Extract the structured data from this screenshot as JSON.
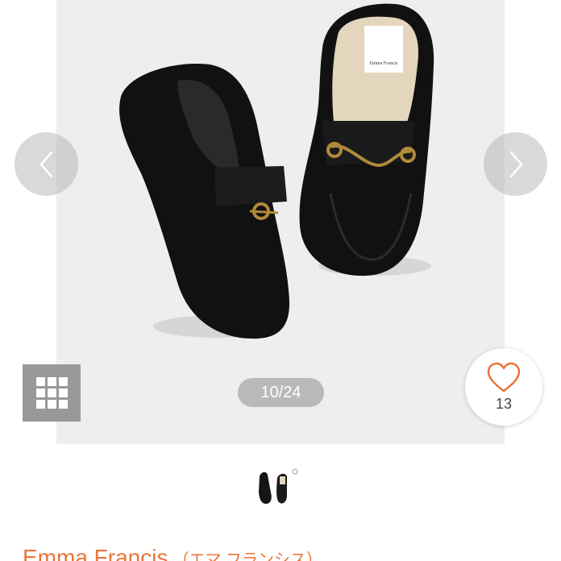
{
  "gallery": {
    "counter_current": "10",
    "counter_separator": "/",
    "counter_total": "24",
    "like_count": "13",
    "insole_brand_text": "Emma Francis"
  },
  "thumbnails": [
    {
      "selected": true
    }
  ],
  "product": {
    "brand_name": "Emma Francis",
    "brand_kana": "（エマ フランシス）"
  },
  "colors": {
    "accent": "#e8753a",
    "heart": "#e8753a",
    "photo_background": "#eeeeed"
  },
  "icons": {
    "prev": "chevron-left-icon",
    "next": "chevron-right-icon",
    "grid": "grid-icon",
    "like": "heart-icon"
  }
}
